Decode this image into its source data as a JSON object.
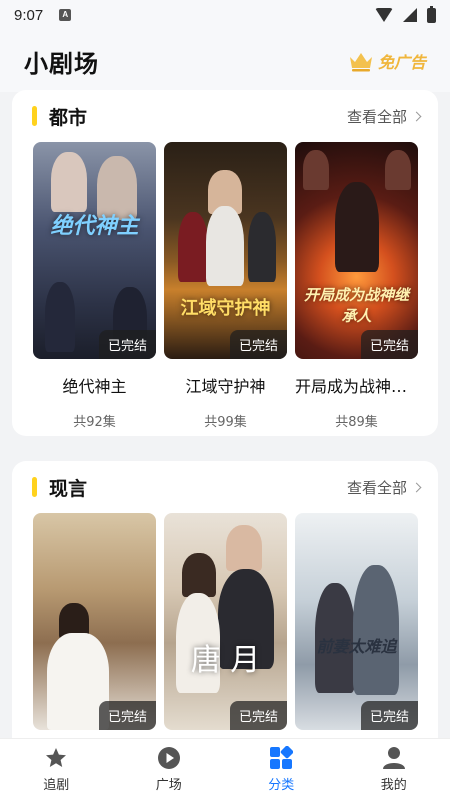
{
  "status_bar": {
    "time": "9:07",
    "app_badge": "A"
  },
  "header": {
    "title": "小剧场",
    "ad_free_label": "免广告"
  },
  "sections": [
    {
      "title": "都市",
      "view_all": "查看全部",
      "items": [
        {
          "title": "绝代神主",
          "episodes": "共92集",
          "status": "已完结",
          "poster_text": "绝代神主"
        },
        {
          "title": "江域守护神",
          "episodes": "共99集",
          "status": "已完结",
          "poster_text": "江域守护神"
        },
        {
          "title": "开局成为战神继承人",
          "episodes": "共89集",
          "status": "已完结",
          "poster_text": "开局成为战神继承人"
        }
      ]
    },
    {
      "title": "现言",
      "view_all": "查看全部",
      "items": [
        {
          "status": "已完结"
        },
        {
          "status": "已完结",
          "poster_text": "唐 月"
        },
        {
          "status": "已完结",
          "poster_text": "前妻太难追"
        }
      ]
    }
  ],
  "bottom_nav": [
    {
      "label": "追剧",
      "icon": "star-icon",
      "active": false
    },
    {
      "label": "广场",
      "icon": "play-icon",
      "active": false
    },
    {
      "label": "分类",
      "icon": "category-icon",
      "active": true
    },
    {
      "label": "我的",
      "icon": "profile-icon",
      "active": false
    }
  ],
  "colors": {
    "accent": "#1677ff",
    "section_bar": "#ffd21e",
    "ad_free": "#f0b63c"
  }
}
